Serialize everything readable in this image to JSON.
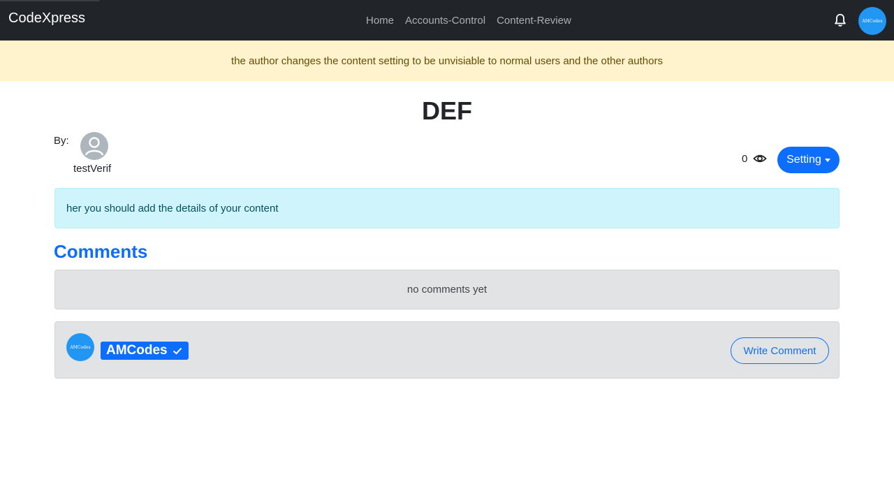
{
  "navbar": {
    "brand": "CodeXpress",
    "links": [
      "Home",
      "Accounts-Control",
      "Content-Review"
    ],
    "avatar_text": "AMCodes"
  },
  "notice": "the author changes the content setting to be unvisiable to normal users and the other authors",
  "content": {
    "title": "DEF",
    "by_label": "By:",
    "author": "testVerif",
    "views": "0",
    "setting_label": "Setting",
    "details": "her you should add the details of your content"
  },
  "comments": {
    "heading": "Comments",
    "empty_text": "no comments yet",
    "current_user": "AMCodes",
    "avatar_text": "AMCodes",
    "write_label": "Write Comment"
  },
  "colors": {
    "navbar_bg": "#212529",
    "primary": "#0d6efd",
    "warning_bg": "#fff3cd",
    "info_bg": "#cff4fc",
    "secondary_bg": "#e2e3e5"
  }
}
